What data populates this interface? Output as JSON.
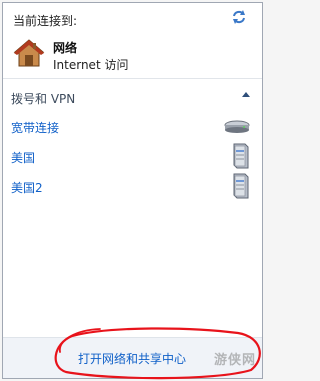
{
  "panel": {
    "connected_label": "当前连接到:",
    "network": {
      "name": "网络",
      "access": "Internet 访问",
      "icon": "house-icon"
    },
    "refresh_icon": "refresh-icon"
  },
  "dialup": {
    "title": "拨号和 VPN",
    "collapse_icon": "chevron-up-icon",
    "items": [
      {
        "label": "宽带连接",
        "icon": "modem-icon"
      },
      {
        "label": "美国",
        "icon": "server-icon"
      },
      {
        "label": "美国2",
        "icon": "server-icon"
      }
    ]
  },
  "footer": {
    "link": "打开网络和共享中心"
  },
  "watermark": "游侠网",
  "colors": {
    "link": "#1060c8",
    "annotation": "#e8131b"
  }
}
